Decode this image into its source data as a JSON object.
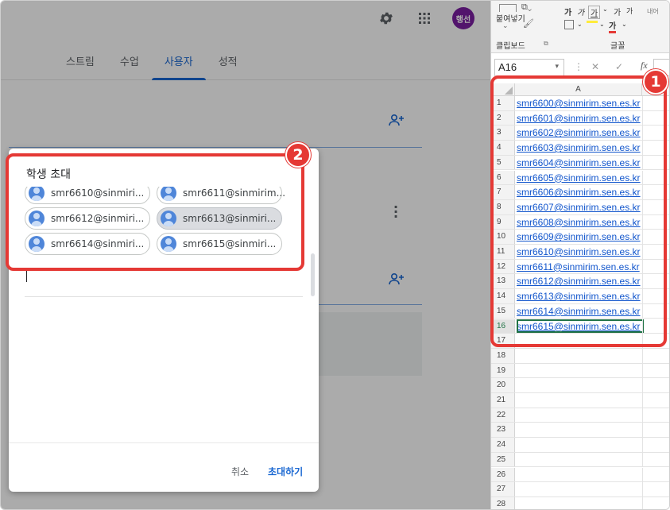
{
  "classroom": {
    "avatar_text": "행선",
    "tabs": [
      {
        "label": "스트림",
        "active": false
      },
      {
        "label": "수업",
        "active": false
      },
      {
        "label": "사용자",
        "active": true
      },
      {
        "label": "성적",
        "active": false
      }
    ]
  },
  "dialog": {
    "title": "학생 초대",
    "chips": [
      {
        "text": "smr6610@sinmiri...",
        "selected": false
      },
      {
        "text": "smr6611@sinmirim...",
        "selected": false
      },
      {
        "text": "smr6612@sinmiri...",
        "selected": false
      },
      {
        "text": "smr6613@sinmiri...",
        "selected": true
      },
      {
        "text": "smr6614@sinmiri...",
        "selected": false
      },
      {
        "text": "smr6615@sinmiri...",
        "selected": false
      }
    ],
    "cancel_label": "취소",
    "invite_label": "초대하기"
  },
  "excel": {
    "ribbon": {
      "paste_label": "붙여넣기",
      "font_label1": "가",
      "font_label2": "가",
      "font_label3": "가",
      "font_label4": "가",
      "font_label5": "가",
      "font_label6": "가",
      "clipboard_label": "클립보드",
      "font_group_label": "글꼴",
      "extra": "내어"
    },
    "name_box": "A16",
    "fx_symbol": "fx",
    "column_header": "A",
    "rows": [
      {
        "num": "1",
        "value": "smr6600@sinmirim.sen.es.kr"
      },
      {
        "num": "2",
        "value": "smr6601@sinmirim.sen.es.kr"
      },
      {
        "num": "3",
        "value": "smr6602@sinmirim.sen.es.kr"
      },
      {
        "num": "4",
        "value": "smr6603@sinmirim.sen.es.kr"
      },
      {
        "num": "5",
        "value": "smr6604@sinmirim.sen.es.kr"
      },
      {
        "num": "6",
        "value": "smr6605@sinmirim.sen.es.kr"
      },
      {
        "num": "7",
        "value": "smr6606@sinmirim.sen.es.kr"
      },
      {
        "num": "8",
        "value": "smr6607@sinmirim.sen.es.kr"
      },
      {
        "num": "9",
        "value": "smr6608@sinmirim.sen.es.kr"
      },
      {
        "num": "10",
        "value": "smr6609@sinmirim.sen.es.kr"
      },
      {
        "num": "11",
        "value": "smr6610@sinmirim.sen.es.kr"
      },
      {
        "num": "12",
        "value": "smr6611@sinmirim.sen.es.kr"
      },
      {
        "num": "13",
        "value": "smr6612@sinmirim.sen.es.kr"
      },
      {
        "num": "14",
        "value": "smr6613@sinmirim.sen.es.kr"
      },
      {
        "num": "15",
        "value": "smr6614@sinmirim.sen.es.kr"
      },
      {
        "num": "16",
        "value": "smr6615@sinmirim.sen.es.kr"
      },
      {
        "num": "17",
        "value": ""
      },
      {
        "num": "18",
        "value": ""
      },
      {
        "num": "19",
        "value": ""
      },
      {
        "num": "20",
        "value": ""
      },
      {
        "num": "21",
        "value": ""
      },
      {
        "num": "22",
        "value": ""
      },
      {
        "num": "23",
        "value": ""
      },
      {
        "num": "24",
        "value": ""
      },
      {
        "num": "25",
        "value": ""
      },
      {
        "num": "26",
        "value": ""
      },
      {
        "num": "27",
        "value": ""
      },
      {
        "num": "28",
        "value": ""
      }
    ]
  },
  "annotations": {
    "badge1": "1",
    "badge2": "2",
    "highlight_color": "#e53935"
  },
  "colors": {
    "accent": "#1967d2",
    "excel_green": "#217346",
    "link_blue": "#1155cc",
    "avatar_purple": "#7b1fa2"
  },
  "icons": [
    "settings-gear-icon",
    "apps-grid-icon",
    "add-person-icon",
    "more-vert-icon",
    "person-avatar-icon"
  ]
}
